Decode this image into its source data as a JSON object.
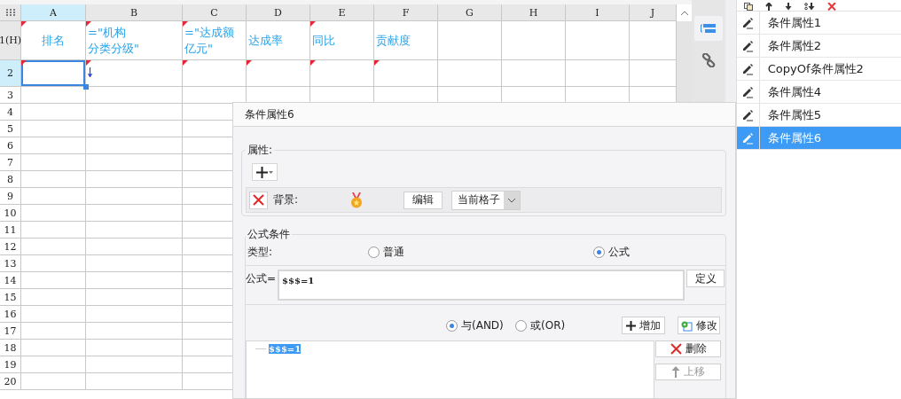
{
  "sheet": {
    "columns": [
      {
        "label": "A",
        "selected": true
      },
      {
        "label": "B",
        "selected": false
      },
      {
        "label": "C",
        "selected": false
      },
      {
        "label": "D",
        "selected": false
      },
      {
        "label": "E",
        "selected": false
      },
      {
        "label": "F",
        "selected": false
      },
      {
        "label": "G",
        "selected": false
      },
      {
        "label": "H",
        "selected": false
      },
      {
        "label": "I",
        "selected": false
      },
      {
        "label": "J",
        "selected": false
      }
    ],
    "rows": [
      {
        "label": "1(H)",
        "cells": [
          {
            "lines": [
              "排名"
            ],
            "marked": true,
            "selected": false
          },
          {
            "lines": [
              "=\"机构",
              "分类分级\""
            ],
            "marked": true,
            "selected": false
          },
          {
            "lines": [
              "=\"达成额",
              "亿元\""
            ],
            "marked": true,
            "selected": false
          },
          {
            "lines": [
              "达成率"
            ],
            "marked": false,
            "selected": false
          },
          {
            "lines": [
              "同比"
            ],
            "marked": true,
            "selected": false
          },
          {
            "lines": [
              "贡献度"
            ],
            "marked": false,
            "selected": false
          }
        ]
      },
      {
        "label": "2",
        "cells": [
          {
            "marked": true,
            "selected": true,
            "expand_down": false
          },
          {
            "marked": true,
            "selected": false,
            "expand_down": true
          },
          {
            "marked": true,
            "selected": false,
            "expand_down": false
          },
          {
            "marked": true,
            "selected": false,
            "expand_down": false
          },
          {
            "marked": true,
            "selected": false,
            "expand_down": false
          },
          {
            "marked": true,
            "selected": false,
            "expand_down": false
          }
        ]
      },
      {
        "label": "3"
      },
      {
        "label": "4"
      },
      {
        "label": "5"
      },
      {
        "label": "6"
      },
      {
        "label": "7"
      },
      {
        "label": "8"
      },
      {
        "label": "9"
      },
      {
        "label": "10"
      },
      {
        "label": "11"
      },
      {
        "label": "12"
      },
      {
        "label": "13"
      },
      {
        "label": "14"
      },
      {
        "label": "15"
      },
      {
        "label": "16"
      },
      {
        "label": "17"
      },
      {
        "label": "18"
      },
      {
        "label": "19"
      },
      {
        "label": "20"
      }
    ]
  },
  "condition_list": {
    "items": [
      {
        "label": "条件属性1",
        "selected": false
      },
      {
        "label": "条件属性2",
        "selected": false
      },
      {
        "label": "CopyOf条件属性2",
        "selected": false
      },
      {
        "label": "条件属性4",
        "selected": false
      },
      {
        "label": "条件属性5",
        "selected": false
      },
      {
        "label": "条件属性6",
        "selected": true
      }
    ]
  },
  "dialog": {
    "title": "条件属性6",
    "properties": {
      "legend": "属性:",
      "rows": [
        {
          "label": "背景:",
          "edit_button": "编辑",
          "scope": "当前格子"
        }
      ]
    },
    "formula_condition": {
      "legend": "公式条件",
      "type_label": "类型:",
      "types": [
        {
          "label": "普通",
          "selected": false
        },
        {
          "label": "公式",
          "selected": true
        }
      ],
      "formula_label": "公式=",
      "formula": "$$$=1",
      "define_button": "定义",
      "joins": [
        {
          "label": "与(AND)",
          "selected": true
        },
        {
          "label": "或(OR)",
          "selected": false
        }
      ],
      "add_button": "增加",
      "modify_button": "修改",
      "conditions": [
        {
          "text": "$$$=1",
          "selected": true
        }
      ],
      "side_buttons": [
        {
          "label": "删除",
          "kind": "delete",
          "disabled": false
        },
        {
          "label": "上移",
          "kind": "up",
          "disabled": true
        }
      ]
    }
  }
}
